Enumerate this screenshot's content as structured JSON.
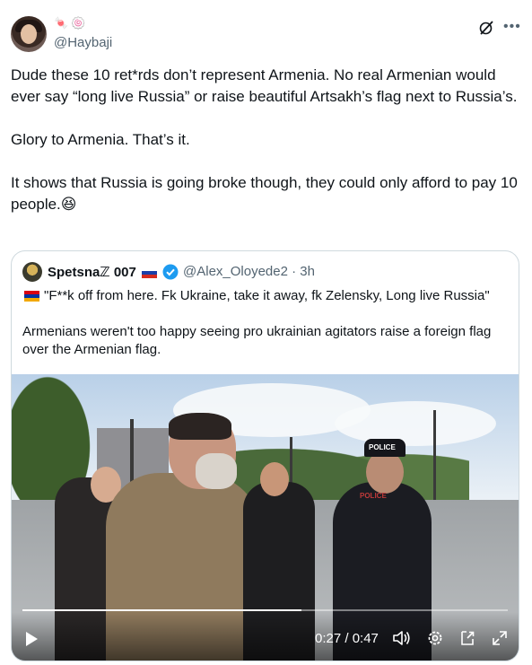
{
  "tweet": {
    "emoji": [
      "🍬",
      "🍥"
    ],
    "handle": "@Haybaji",
    "paragraphs": [
      "Dude these 10 ret*rds don’t represent Armenia. No real Armenian would ever say “long live Russia” or raise beautiful Artsakh’s flag next to Russia’s.",
      "Glory to Armenia. That’s it.",
      "It shows that Russia is going broke though, they could only afford to pay 10 people.😆"
    ]
  },
  "quote": {
    "name": "Spetsnaℤ 007",
    "meta": "@Alex_Oloyede2 · 3h",
    "line1": "\"F**k off from here. Fk Ukraine, take it away, fk Zelensky, Long live Russia\"",
    "line2": "Armenians weren't too happy seeing pro ukrainian agitators raise a foreign flag over the Armenian flag.",
    "flag_ru_colors": [
      "#ffffff",
      "#1c3fa8",
      "#d52b1e"
    ],
    "flag_am_colors": [
      "#d90012",
      "#0033a0",
      "#f2a800"
    ]
  },
  "video": {
    "time": "0:27 / 0:47",
    "progress": 0.574,
    "police_cap": "POLICE",
    "police_badge": "POLICE"
  },
  "colors": {
    "text": "#0f1419",
    "secondary": "#536471",
    "border": "#cfd9de",
    "verified": "#1d9bf0"
  }
}
